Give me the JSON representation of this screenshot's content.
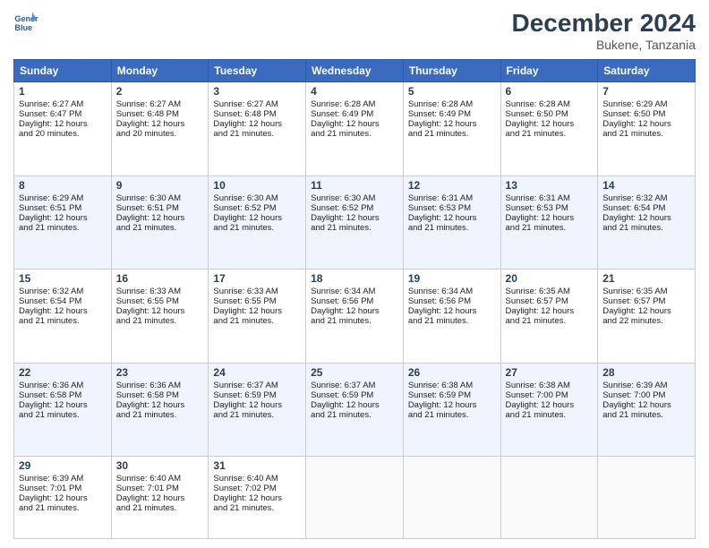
{
  "header": {
    "logo_line1": "General",
    "logo_line2": "Blue",
    "month": "December 2024",
    "location": "Bukene, Tanzania"
  },
  "weekdays": [
    "Sunday",
    "Monday",
    "Tuesday",
    "Wednesday",
    "Thursday",
    "Friday",
    "Saturday"
  ],
  "weeks": [
    [
      {
        "day": "1",
        "lines": [
          "Sunrise: 6:27 AM",
          "Sunset: 6:47 PM",
          "Daylight: 12 hours",
          "and 20 minutes."
        ]
      },
      {
        "day": "2",
        "lines": [
          "Sunrise: 6:27 AM",
          "Sunset: 6:48 PM",
          "Daylight: 12 hours",
          "and 20 minutes."
        ]
      },
      {
        "day": "3",
        "lines": [
          "Sunrise: 6:27 AM",
          "Sunset: 6:48 PM",
          "Daylight: 12 hours",
          "and 21 minutes."
        ]
      },
      {
        "day": "4",
        "lines": [
          "Sunrise: 6:28 AM",
          "Sunset: 6:49 PM",
          "Daylight: 12 hours",
          "and 21 minutes."
        ]
      },
      {
        "day": "5",
        "lines": [
          "Sunrise: 6:28 AM",
          "Sunset: 6:49 PM",
          "Daylight: 12 hours",
          "and 21 minutes."
        ]
      },
      {
        "day": "6",
        "lines": [
          "Sunrise: 6:28 AM",
          "Sunset: 6:50 PM",
          "Daylight: 12 hours",
          "and 21 minutes."
        ]
      },
      {
        "day": "7",
        "lines": [
          "Sunrise: 6:29 AM",
          "Sunset: 6:50 PM",
          "Daylight: 12 hours",
          "and 21 minutes."
        ]
      }
    ],
    [
      {
        "day": "8",
        "lines": [
          "Sunrise: 6:29 AM",
          "Sunset: 6:51 PM",
          "Daylight: 12 hours",
          "and 21 minutes."
        ]
      },
      {
        "day": "9",
        "lines": [
          "Sunrise: 6:30 AM",
          "Sunset: 6:51 PM",
          "Daylight: 12 hours",
          "and 21 minutes."
        ]
      },
      {
        "day": "10",
        "lines": [
          "Sunrise: 6:30 AM",
          "Sunset: 6:52 PM",
          "Daylight: 12 hours",
          "and 21 minutes."
        ]
      },
      {
        "day": "11",
        "lines": [
          "Sunrise: 6:30 AM",
          "Sunset: 6:52 PM",
          "Daylight: 12 hours",
          "and 21 minutes."
        ]
      },
      {
        "day": "12",
        "lines": [
          "Sunrise: 6:31 AM",
          "Sunset: 6:53 PM",
          "Daylight: 12 hours",
          "and 21 minutes."
        ]
      },
      {
        "day": "13",
        "lines": [
          "Sunrise: 6:31 AM",
          "Sunset: 6:53 PM",
          "Daylight: 12 hours",
          "and 21 minutes."
        ]
      },
      {
        "day": "14",
        "lines": [
          "Sunrise: 6:32 AM",
          "Sunset: 6:54 PM",
          "Daylight: 12 hours",
          "and 21 minutes."
        ]
      }
    ],
    [
      {
        "day": "15",
        "lines": [
          "Sunrise: 6:32 AM",
          "Sunset: 6:54 PM",
          "Daylight: 12 hours",
          "and 21 minutes."
        ]
      },
      {
        "day": "16",
        "lines": [
          "Sunrise: 6:33 AM",
          "Sunset: 6:55 PM",
          "Daylight: 12 hours",
          "and 21 minutes."
        ]
      },
      {
        "day": "17",
        "lines": [
          "Sunrise: 6:33 AM",
          "Sunset: 6:55 PM",
          "Daylight: 12 hours",
          "and 21 minutes."
        ]
      },
      {
        "day": "18",
        "lines": [
          "Sunrise: 6:34 AM",
          "Sunset: 6:56 PM",
          "Daylight: 12 hours",
          "and 21 minutes."
        ]
      },
      {
        "day": "19",
        "lines": [
          "Sunrise: 6:34 AM",
          "Sunset: 6:56 PM",
          "Daylight: 12 hours",
          "and 21 minutes."
        ]
      },
      {
        "day": "20",
        "lines": [
          "Sunrise: 6:35 AM",
          "Sunset: 6:57 PM",
          "Daylight: 12 hours",
          "and 21 minutes."
        ]
      },
      {
        "day": "21",
        "lines": [
          "Sunrise: 6:35 AM",
          "Sunset: 6:57 PM",
          "Daylight: 12 hours",
          "and 22 minutes."
        ]
      }
    ],
    [
      {
        "day": "22",
        "lines": [
          "Sunrise: 6:36 AM",
          "Sunset: 6:58 PM",
          "Daylight: 12 hours",
          "and 21 minutes."
        ]
      },
      {
        "day": "23",
        "lines": [
          "Sunrise: 6:36 AM",
          "Sunset: 6:58 PM",
          "Daylight: 12 hours",
          "and 21 minutes."
        ]
      },
      {
        "day": "24",
        "lines": [
          "Sunrise: 6:37 AM",
          "Sunset: 6:59 PM",
          "Daylight: 12 hours",
          "and 21 minutes."
        ]
      },
      {
        "day": "25",
        "lines": [
          "Sunrise: 6:37 AM",
          "Sunset: 6:59 PM",
          "Daylight: 12 hours",
          "and 21 minutes."
        ]
      },
      {
        "day": "26",
        "lines": [
          "Sunrise: 6:38 AM",
          "Sunset: 6:59 PM",
          "Daylight: 12 hours",
          "and 21 minutes."
        ]
      },
      {
        "day": "27",
        "lines": [
          "Sunrise: 6:38 AM",
          "Sunset: 7:00 PM",
          "Daylight: 12 hours",
          "and 21 minutes."
        ]
      },
      {
        "day": "28",
        "lines": [
          "Sunrise: 6:39 AM",
          "Sunset: 7:00 PM",
          "Daylight: 12 hours",
          "and 21 minutes."
        ]
      }
    ],
    [
      {
        "day": "29",
        "lines": [
          "Sunrise: 6:39 AM",
          "Sunset: 7:01 PM",
          "Daylight: 12 hours",
          "and 21 minutes."
        ]
      },
      {
        "day": "30",
        "lines": [
          "Sunrise: 6:40 AM",
          "Sunset: 7:01 PM",
          "Daylight: 12 hours",
          "and 21 minutes."
        ]
      },
      {
        "day": "31",
        "lines": [
          "Sunrise: 6:40 AM",
          "Sunset: 7:02 PM",
          "Daylight: 12 hours",
          "and 21 minutes."
        ]
      },
      null,
      null,
      null,
      null
    ]
  ]
}
